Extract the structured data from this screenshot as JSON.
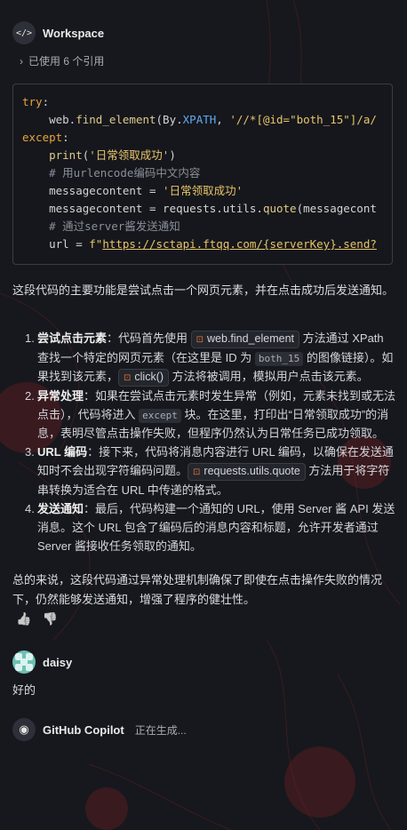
{
  "workspace": {
    "name": "Workspace",
    "references": "已使用 6 个引用"
  },
  "code_lines": [
    [
      {
        "c": "kw",
        "t": "try"
      },
      {
        "c": "",
        "t": ":"
      }
    ],
    [
      {
        "c": "",
        "t": "    web."
      },
      {
        "c": "fn",
        "t": "find_element"
      },
      {
        "c": "",
        "t": "(By."
      },
      {
        "c": "cs",
        "t": "XPATH"
      },
      {
        "c": "",
        "t": ", "
      },
      {
        "c": "st",
        "t": "'//*[@id=\"both_15\"]/a/"
      }
    ],
    [
      {
        "c": "kw",
        "t": "except"
      },
      {
        "c": "",
        "t": ":"
      }
    ],
    [
      {
        "c": "",
        "t": "    "
      },
      {
        "c": "fn",
        "t": "print"
      },
      {
        "c": "",
        "t": "("
      },
      {
        "c": "st",
        "t": "'日常领取成功'"
      },
      {
        "c": "",
        "t": ")"
      }
    ],
    [
      {
        "c": "cm",
        "t": "    # 用urlencode编码中文内容"
      }
    ],
    [
      {
        "c": "",
        "t": "    messagecontent = "
      },
      {
        "c": "st",
        "t": "'日常领取成功'"
      }
    ],
    [
      {
        "c": "",
        "t": "    messagecontent = requests.utils."
      },
      {
        "c": "fn",
        "t": "quote"
      },
      {
        "c": "",
        "t": "(messagecont"
      }
    ],
    [
      {
        "c": "cm",
        "t": "    # 通过server酱发送通知"
      }
    ],
    [
      {
        "c": "",
        "t": "    url = "
      },
      {
        "c": "st",
        "t": "f\""
      },
      {
        "c": "st ul",
        "t": "https://sctapi.ftqq.com/{serverKey}.send?"
      }
    ]
  ],
  "intro": "这段代码的主要功能是尝试点击一个网页元素，并在点击成功后发送通知。",
  "items": [
    {
      "num": "1.",
      "title": "尝试点击元素",
      "a": "：代码首先使用 ",
      "chip1": "web.find_element",
      "b": " 方法通过 XPath 查找一个特定的网页元素（在这里是 ID 为 ",
      "code1": "both_15",
      "c": " 的图像链接）。如果找到该元素，",
      "chip2": "click()",
      "d": " 方法将被调用，模拟用户点击该元素。"
    },
    {
      "num": "2.",
      "title": "异常处理",
      "a": "：如果在尝试点击元素时发生异常（例如，元素未找到或无法点击），代码将进入 ",
      "code1": "except",
      "b": " 块。在这里，打印出“日常领取成功”的消息，表明尽管点击操作失败，但程序仍然认为日常任务已成功领取。"
    },
    {
      "num": "3.",
      "title": "URL 编码",
      "a": "：接下来，代码将消息内容进行 URL 编码，以确保在发送通知时不会出现字符编码问题。",
      "chip1": "requests.utils.quote",
      "b": " 方法用于将字符串转换为适合在 URL 中传递的格式。"
    },
    {
      "num": "4.",
      "title": "发送通知",
      "a": "：最后，代码构建一个通知的 URL，使用 Server 酱 API 发送消息。这个 URL 包含了编码后的消息内容和标题，允许开发者通过 Server 酱接收任务领取的通知。"
    }
  ],
  "summary": "总的来说，这段代码通过异常处理机制确保了即使在点击操作失败的情况下，仍然能够发送通知，增强了程序的健壮性。",
  "user": {
    "name": "daisy",
    "message": "好的"
  },
  "copilot": {
    "name": "GitHub Copilot",
    "status": "正在生成..."
  },
  "icons": {
    "workspace": "</>",
    "chevron": "›",
    "thumb_up": "👍",
    "thumb_down": "👎",
    "chip": "⊡"
  }
}
